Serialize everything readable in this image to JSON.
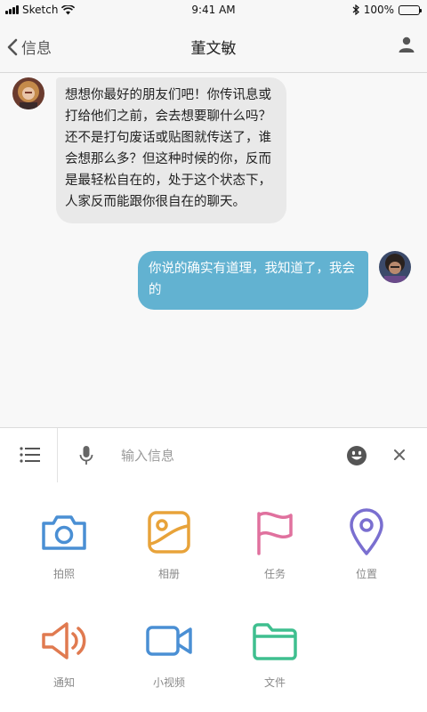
{
  "status_bar": {
    "carrier": "Sketch",
    "time": "9:41 AM",
    "battery": "100%"
  },
  "nav": {
    "back_label": "信息",
    "title": "董文敏"
  },
  "messages": [
    {
      "direction": "incoming",
      "text": "想想你最好的朋友们吧！你传讯息或打给他们之前，会去想要聊什么吗？还不是打句废话或贴图就传送了，谁会想那么多？但这种时候的你，反而是最轻松自在的，处于这个状态下，人家反而能跟你很自在的聊天。"
    },
    {
      "direction": "outgoing",
      "text": "你说的确实有道理，我知道了，我会的"
    }
  ],
  "input": {
    "placeholder": "输入信息"
  },
  "attachments": [
    {
      "label": "拍照",
      "icon": "camera-icon",
      "color": "#4a8fd4"
    },
    {
      "label": "相册",
      "icon": "album-icon",
      "color": "#e8a33a"
    },
    {
      "label": "任务",
      "icon": "flag-icon",
      "color": "#e0719e"
    },
    {
      "label": "位置",
      "icon": "location-pin-icon",
      "color": "#7a6fd0"
    },
    {
      "label": "通知",
      "icon": "speaker-icon",
      "color": "#e07a50"
    },
    {
      "label": "小视频",
      "icon": "video-camera-icon",
      "color": "#4a8fd4"
    },
    {
      "label": "文件",
      "icon": "folder-icon",
      "color": "#3fbf8f"
    }
  ],
  "colors": {
    "incoming_bubble": "#e9e9e9",
    "outgoing_bubble": "#62b2d1"
  }
}
